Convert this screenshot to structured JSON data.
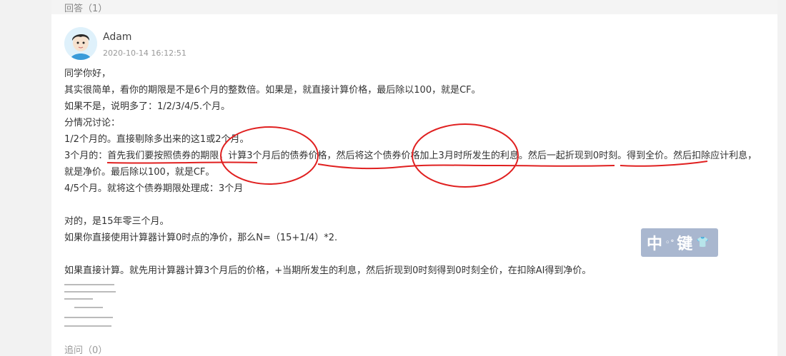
{
  "header": {
    "label": "回答（1）"
  },
  "answer": {
    "author": "Adam",
    "timestamp": "2020-10-14 16:12:51",
    "lines": [
      "同学你好，",
      "其实很简单，看你的期限是不是6个月的整数倍。如果是，就直接计算价格，最后除以100，就是CF。",
      "如果不是，说明多了：1/2/3/4/5.个月。",
      "分情况讨论：",
      "1/2个月的。直接剔除多出来的这1或2个月。",
      "3个月的：首先我们要按照债券的期限，计算3个月后的债券价格，然后将这个债券价格加上3月时所发生的利息。然后一起折现到0时刻。得到全价。然后扣除应计利息，就是净价。最后除以100，就是CF。",
      "4/5个月。就将这个债券期限处理成：3个月",
      "",
      "对的，是15年零三个月。",
      "如果你直接使用计算器计算0时点的净价，那么N=（15+1/4）*2.",
      "",
      "如果直接计算。就先用计算器计算3个月后的价格，+当期所发生的利息，然后折现到0时刻得到0时刻全价，在扣除AI得到净价。"
    ]
  },
  "widget": {
    "text_left": "中",
    "dot": "◦°",
    "text_right": "键",
    "icon": "shirt-icon"
  },
  "footer": {
    "label": "追问（0）"
  },
  "colors": {
    "annotation": "#e02020",
    "widget_bg": "#a9b7cf"
  }
}
